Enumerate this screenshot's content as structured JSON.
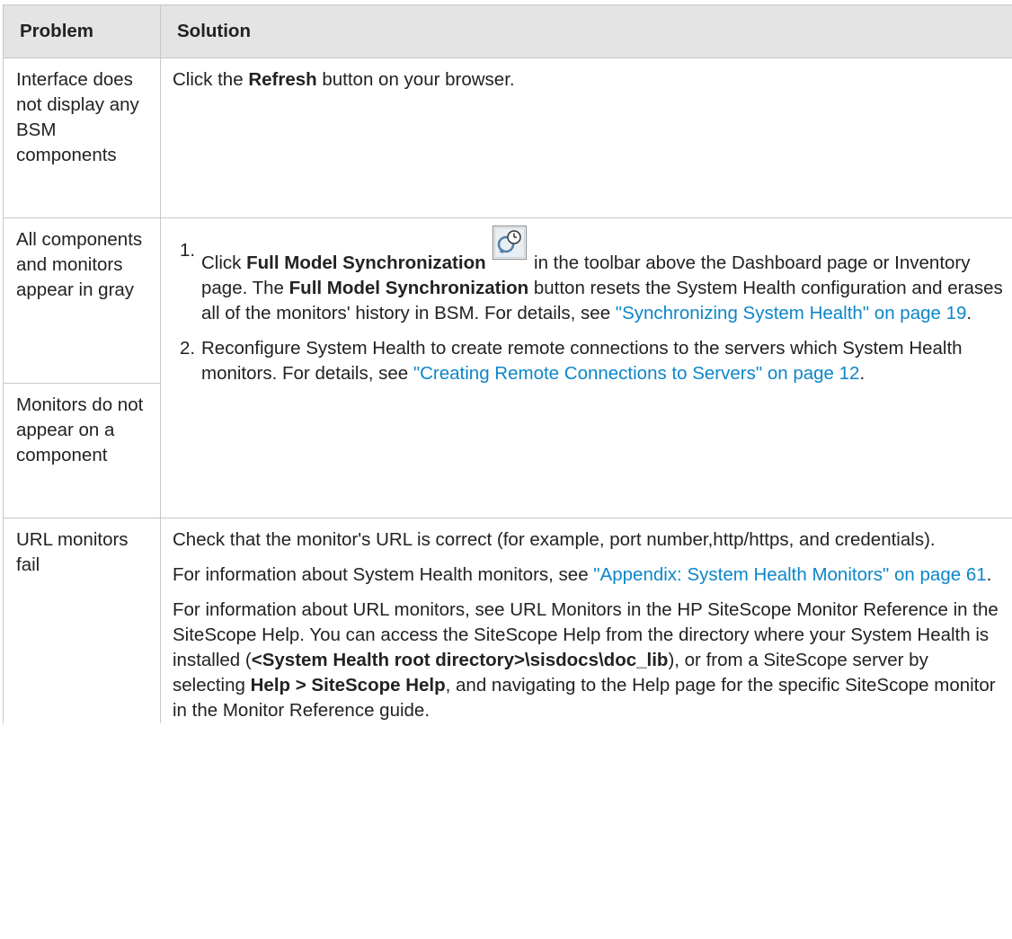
{
  "header": {
    "problem": "Problem",
    "solution": "Solution"
  },
  "rows": [
    {
      "problem": "Interface does not display any BSM components",
      "solution": {
        "pre": "Click the ",
        "bold": "Refresh",
        "post": " button on your browser."
      }
    },
    {
      "problem_a": "All components and monitors appear in gray",
      "problem_b": "Monitors do not appear on a component",
      "step1": {
        "num": "1.",
        "t1": "Click ",
        "b1": "Full Model Synchronization",
        "icon": "full-model-synchronization-icon",
        "t2": " in the toolbar above the Dashboard page or Inventory page. The ",
        "b2": "Full Model Synchronization",
        "t3": " button resets the System Health configuration and erases all of the monitors' history in BSM. For details, see ",
        "link": "\"Synchronizing System Health\" on page 19",
        "t4": "."
      },
      "step2": {
        "num": "2.",
        "t1": "Reconfigure System Health to create remote connections to the servers which System Health monitors. For details, see ",
        "link": "\"Creating Remote Connections to Servers\" on page 12",
        "t2": "."
      }
    },
    {
      "problem": "URL monitors fail",
      "p1": "Check that the monitor's URL is correct (for example, port number,http/https, and credentials).",
      "p2": {
        "t1": "For information about System Health monitors, see ",
        "link": "\"Appendix: System Health Monitors\" on page 61",
        "t2": "."
      },
      "p3": {
        "t1": "For information about URL monitors, see URL Monitors in the HP SiteScope Monitor Reference in the SiteScope Help. You can access the SiteScope Help from the directory where your System Health is installed (",
        "b1": "<System Health root directory>\\sisdocs\\doc_lib",
        "t2": "), or from a SiteScope server by selecting ",
        "b2": "Help > SiteScope Help",
        "t3": ", and navigating to the Help page for the specific SiteScope monitor in the Monitor Reference guide."
      }
    }
  ]
}
